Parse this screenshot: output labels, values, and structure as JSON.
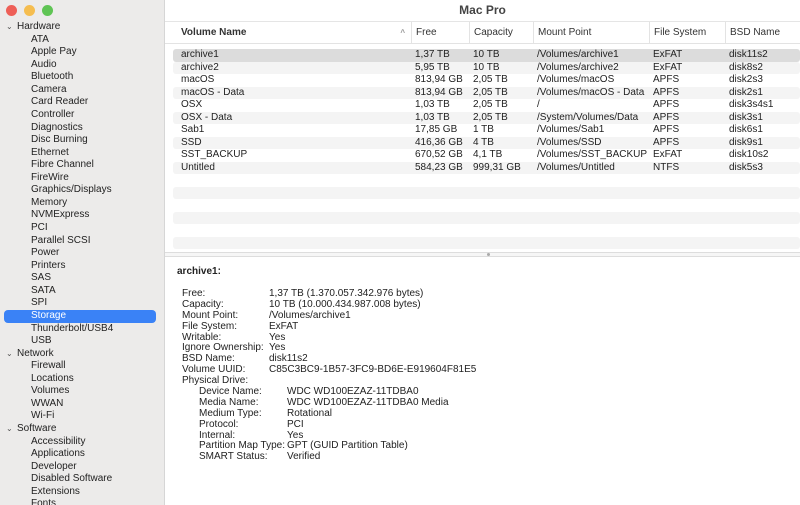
{
  "window": {
    "title": "Mac Pro",
    "traffic_lights": {
      "close": "#ee5f57",
      "minimize": "#f5bd4f",
      "zoom": "#5fc454"
    }
  },
  "sidebar": {
    "groups": [
      {
        "label": "Hardware",
        "items": [
          "ATA",
          "Apple Pay",
          "Audio",
          "Bluetooth",
          "Camera",
          "Card Reader",
          "Controller",
          "Diagnostics",
          "Disc Burning",
          "Ethernet",
          "Fibre Channel",
          "FireWire",
          "Graphics/Displays",
          "Memory",
          "NVMExpress",
          "PCI",
          "Parallel SCSI",
          "Power",
          "Printers",
          "SAS",
          "SATA",
          "SPI",
          "Storage",
          "Thunderbolt/USB4",
          "USB"
        ]
      },
      {
        "label": "Network",
        "items": [
          "Firewall",
          "Locations",
          "Volumes",
          "WWAN",
          "Wi-Fi"
        ]
      },
      {
        "label": "Software",
        "items": [
          "Accessibility",
          "Applications",
          "Developer",
          "Disabled Software",
          "Extensions",
          "Fonts"
        ]
      }
    ],
    "selected": "Storage"
  },
  "table": {
    "headers": [
      "Volume Name",
      "Free",
      "Capacity",
      "Mount Point",
      "File System",
      "BSD Name"
    ],
    "rows": [
      [
        "archive1",
        "1,37 TB",
        "10 TB",
        "/Volumes/archive1",
        "ExFAT",
        "disk11s2"
      ],
      [
        "archive2",
        "5,95 TB",
        "10 TB",
        "/Volumes/archive2",
        "ExFAT",
        "disk8s2"
      ],
      [
        "macOS",
        "813,94 GB",
        "2,05 TB",
        "/Volumes/macOS",
        "APFS",
        "disk2s3"
      ],
      [
        "macOS - Data",
        "813,94 GB",
        "2,05 TB",
        "/Volumes/macOS - Data",
        "APFS",
        "disk2s1"
      ],
      [
        "OSX",
        "1,03 TB",
        "2,05 TB",
        "/",
        "APFS",
        "disk3s4s1"
      ],
      [
        "OSX - Data",
        "1,03 TB",
        "2,05 TB",
        "/System/Volumes/Data",
        "APFS",
        "disk3s1"
      ],
      [
        "Sab1",
        "17,85 GB",
        "1 TB",
        "/Volumes/Sab1",
        "APFS",
        "disk6s1"
      ],
      [
        "SSD",
        "416,36 GB",
        "4 TB",
        "/Volumes/SSD",
        "APFS",
        "disk9s1"
      ],
      [
        "SST_BACKUP",
        "670,52 GB",
        "4,1 TB",
        "/Volumes/SST_BACKUP",
        "ExFAT",
        "disk10s2"
      ],
      [
        "Untitled",
        "584,23 GB",
        "999,31 GB",
        "/Volumes/Untitled",
        "NTFS",
        "disk5s3"
      ]
    ]
  },
  "detail": {
    "title": "archive1:",
    "fields": [
      [
        "Free:",
        "1,37 TB (1.370.057.342.976 bytes)"
      ],
      [
        "Capacity:",
        "10 TB (10.000.434.987.008 bytes)"
      ],
      [
        "Mount Point:",
        "/Volumes/archive1"
      ],
      [
        "File System:",
        "ExFAT"
      ],
      [
        "Writable:",
        "Yes"
      ],
      [
        "Ignore Ownership:",
        "Yes"
      ],
      [
        "BSD Name:",
        "disk11s2"
      ],
      [
        "Volume UUID:",
        "C85C3BC9-1B57-3FC9-BD6E-E919604F81E5"
      ],
      [
        "Physical Drive:",
        ""
      ]
    ],
    "physical": [
      [
        "Device Name:",
        "WDC WD100EZAZ-11TDBA0"
      ],
      [
        "Media Name:",
        "WDC WD100EZAZ-11TDBA0 Media"
      ],
      [
        "Medium Type:",
        "Rotational"
      ],
      [
        "Protocol:",
        "PCI"
      ],
      [
        "Internal:",
        "Yes"
      ],
      [
        "Partition Map Type:",
        "GPT (GUID Partition Table)"
      ],
      [
        "SMART Status:",
        "Verified"
      ]
    ]
  }
}
